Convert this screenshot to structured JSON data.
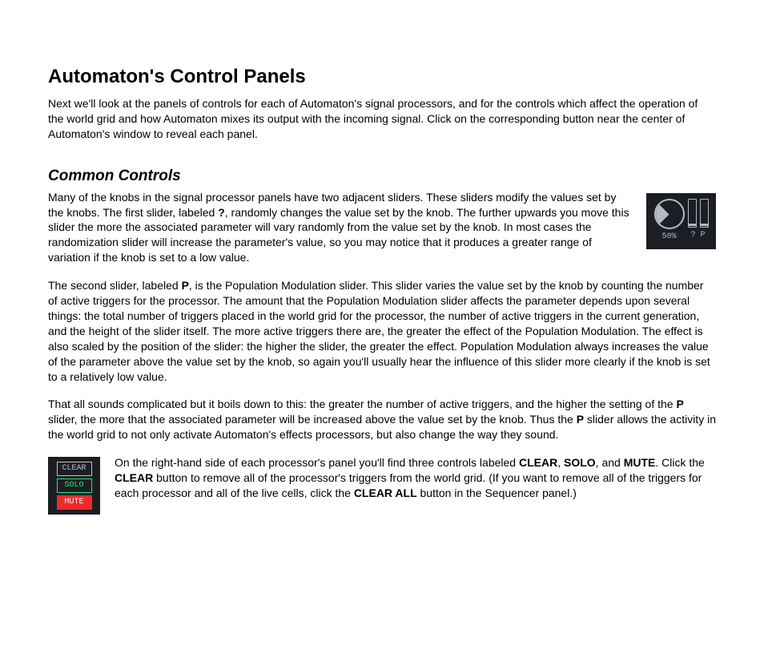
{
  "title": "Automaton's Control Panels",
  "intro": "Next we'll look at the panels of controls for each of Automaton's signal processors, and for the controls which affect the operation of the world grid and how Automaton mixes its output with the incoming signal. Click on the corresponding button near the center of Automaton's window to reveal each panel.",
  "section": {
    "heading": "Common Controls",
    "p1a": "Many of the knobs in the signal processor panels have two adjacent sliders. These sliders modify the values set by the knobs. The first slider, labeled ",
    "p1b": "?",
    "p1c": ", randomly changes the value set by the knob. The further upwards you move this slider the more the associated parameter will vary randomly from the value set by the knob. In most cases the randomization slider will increase the parameter's value, so you may notice that it produces a greater range of variation if the knob is set to a low value.",
    "p2a": "The second slider, labeled ",
    "p2b": "P",
    "p2c": ", is the Population Modulation slider. This slider varies the value set by the knob by counting the number of active triggers for the processor. The amount that the Population Modulation slider affects the parameter depends upon several things: the total number of triggers placed in the world grid for the processor, the number of active triggers in the current generation, and the height of the slider itself. The more active triggers there are, the greater the effect of the Population Modulation. The effect is also scaled by the position of the slider: the higher the slider, the greater the effect. Population Modulation always increases the value of the parameter above the value set by the knob, so again you'll usually hear the influence of this slider more clearly if the knob is set to a relatively low value.",
    "p3a": "That all sounds complicated but it boils down to this: the greater the number of active triggers, and the higher the setting of the ",
    "p3b": "P",
    "p3c": " slider, the more that the associated parameter will be increased above the value set by the knob. Thus the ",
    "p3d": "P",
    "p3e": " slider allows the activity in the world grid to not only activate Automaton's effects processors, but also change the way they sound.",
    "p4a": "On the right-hand side of each processor's panel you'll find three controls labeled ",
    "p4b": "CLEAR",
    "p4c": ", ",
    "p4d": "SOLO",
    "p4e": ", and ",
    "p4f": "MUTE",
    "p4g": ". Click the ",
    "p4h": "CLEAR",
    "p4i": " button to remove all of the processor's triggers from the world grid. (If you want to remove all of the triggers for each processor and all of the live cells, click the ",
    "p4j": "CLEAR ALL",
    "p4k": " button in the Sequencer panel.)"
  },
  "knob_widget": {
    "percent": "50%",
    "rand_label": "?",
    "pop_label": "P"
  },
  "csm_widget": {
    "clear": "CLEAR",
    "solo": "SOLO",
    "mute": "MUTE"
  }
}
